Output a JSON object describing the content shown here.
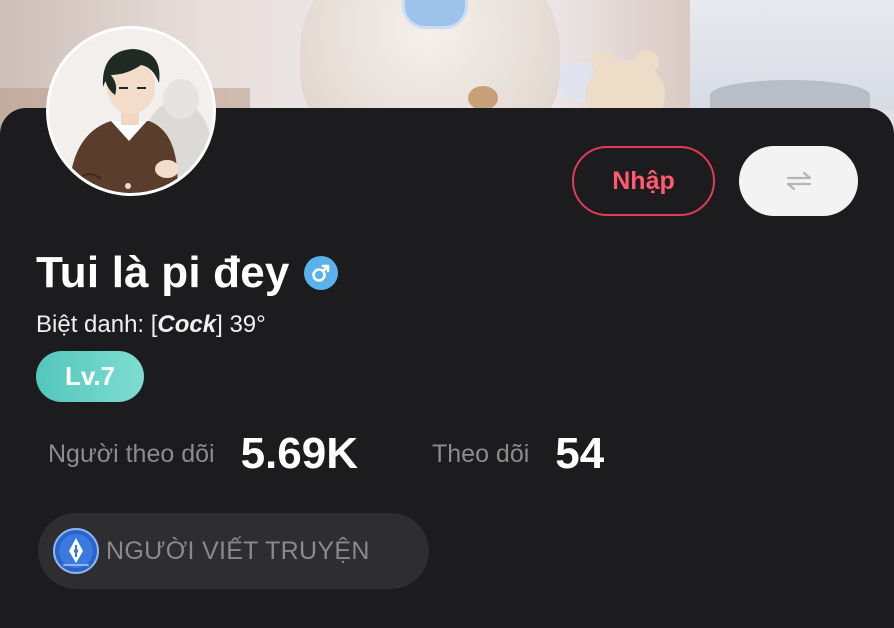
{
  "profile": {
    "name": "Tui là pi đey",
    "gender": "male",
    "nickname_label": "Biệt danh: [",
    "nickname_value": "Cock",
    "nickname_suffix": "] 39°",
    "level": "Lv.7"
  },
  "actions": {
    "import_label": "Nhập",
    "switch_icon": "swap-arrows-icon"
  },
  "stats": {
    "followers_label": "Người theo dõi",
    "followers_value": "5.69K",
    "following_label": "Theo dõi",
    "following_value": "54"
  },
  "tag": {
    "label": "NGƯỜI VIẾT TRUYỆN",
    "icon": "pen-nib-badge-icon"
  },
  "colors": {
    "background": "#1c1c1e",
    "accent_red": "#e23a55",
    "gender_blue": "#5ab2ec",
    "level_teal": "#52c7bc",
    "tag_bg": "#2e2e30"
  }
}
